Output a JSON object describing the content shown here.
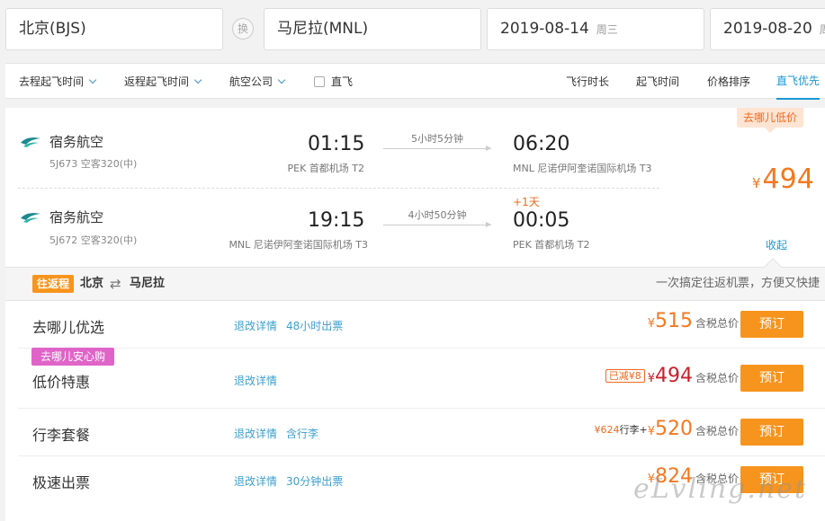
{
  "search": {
    "from": "北京(BJS)",
    "swap": "换",
    "to": "马尼拉(MNL)",
    "depart_date": "2019-08-14",
    "depart_weekday": "周三",
    "return_date": "2019-08-20",
    "return_weekday": "周二"
  },
  "filters": {
    "items": [
      "去程起飞时间",
      "返程起飞时间",
      "航空公司"
    ],
    "direct_label": "直飞"
  },
  "sorts": [
    "飞行时长",
    "起飞时间",
    "价格排序",
    "直飞优先"
  ],
  "card": {
    "low_tag": "去哪儿低价",
    "outbound": {
      "airline": "宿务航空",
      "flight": "5J673 空客320(中)",
      "dep_time": "01:15",
      "dep_airport": "PEK 首都机场 T2",
      "duration": "5小时5分钟",
      "arr_time": "06:20",
      "arr_airport": "MNL 尼诺伊阿奎诺国际机场 T3"
    },
    "inbound": {
      "airline": "宿务航空",
      "flight": "5J672 空客320(中)",
      "dep_time": "19:15",
      "dep_airport": "MNL 尼诺伊阿奎诺国际机场 T3",
      "duration": "4小时50分钟",
      "plus_day": "+1天",
      "arr_time": "00:05",
      "arr_airport": "PEK 首都机场 T2"
    },
    "price_currency": "¥",
    "price": "494",
    "collapse": "收起"
  },
  "roundtrip": {
    "badge": "往返程",
    "from": "北京",
    "to": "马尼拉",
    "slogan": "一次搞定往返机票，方便又快捷"
  },
  "offers": [
    {
      "name": "去哪儿优选",
      "links": [
        "退改详情",
        "48小时出票"
      ],
      "currency": "¥",
      "price": "515",
      "tax": "含税总价",
      "book": "预订"
    },
    {
      "name": "低价特惠",
      "safe_tag": "去哪儿安心购",
      "links": [
        "退改详情"
      ],
      "discount": "已减¥8",
      "currency": "¥",
      "price": "494",
      "tax": "含税总价",
      "book": "预订"
    },
    {
      "name": "行李套餐",
      "links": [
        "退改详情",
        "含行李"
      ],
      "luggage_price": "¥624",
      "luggage_label": "行李+",
      "currency": "¥",
      "price": "520",
      "tax": "含税总价",
      "book": "预订"
    },
    {
      "name": "极速出票",
      "links": [
        "退改详情",
        "30分钟出票"
      ],
      "currency": "¥",
      "price": "824",
      "tax": "含税总价",
      "book": "预订"
    }
  ],
  "watermark": "eLvling.net",
  "colors": {
    "accent": "#1a97d5",
    "orange": "#f47820",
    "button": "#f7941d",
    "pink": "#e064c8"
  }
}
